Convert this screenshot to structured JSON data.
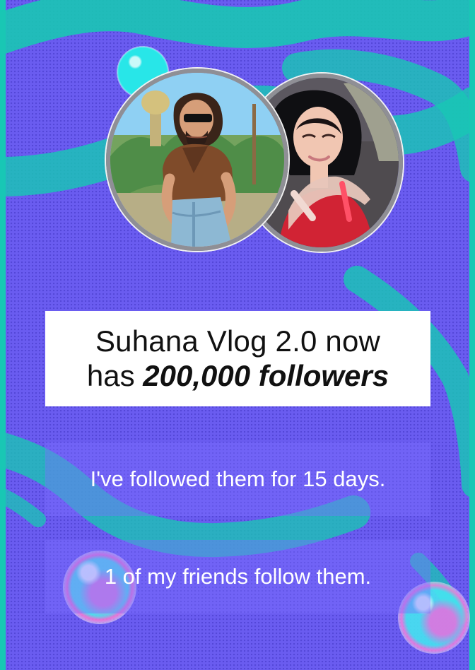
{
  "colors": {
    "background": "#6a5cf0",
    "swirl": "#19c7b4",
    "card_background": "#ffffff",
    "fact_background": "#7d6eff",
    "avatar_border": "#8f8f95"
  },
  "avatars": [
    {
      "icon": "illustrated-man-avatar"
    },
    {
      "icon": "woman-in-red-avatar"
    }
  ],
  "headline": {
    "line1": "Suhana Vlog 2.0 now",
    "line2_prefix": "has ",
    "line2_emphasis": "200,000 followers"
  },
  "facts": [
    "I've followed them for 15 days.",
    "1 of my friends follow them."
  ]
}
